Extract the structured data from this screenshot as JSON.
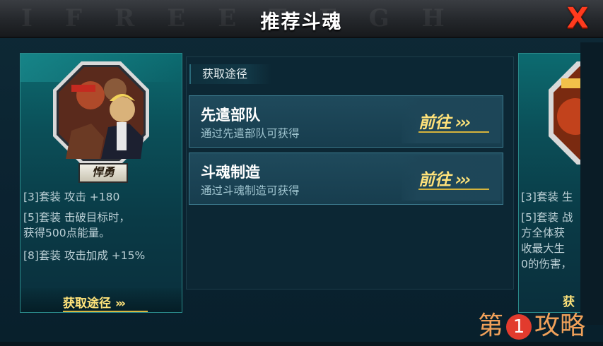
{
  "title": "推荐斗魂",
  "close_label": "X",
  "left_card": {
    "name": "悍勇",
    "set_bonuses": [
      "[3]套装 攻击 +180",
      "[5]套装 击破目标时，",
      "获得500点能量。",
      "[8]套装 攻击加成 +15%"
    ],
    "footer_label": "获取途径"
  },
  "section_label": "获取途径",
  "routes": [
    {
      "name": "先遣部队",
      "desc": "通过先遣部队可获得",
      "button": "前往"
    },
    {
      "name": "斗魂制造",
      "desc": "通过斗魂制造可获得",
      "button": "前往"
    }
  ],
  "right_card": {
    "lines": [
      "[3]套装 生",
      "[5]套装 战",
      "方全体获",
      "收最大生",
      "0的伤害，"
    ],
    "footer_label": "获"
  },
  "watermark": {
    "pre": "第",
    "num": "1",
    "post": "攻略"
  },
  "colors": {
    "accent_gold": "#ffe27a",
    "close_red": "#ff3b1e",
    "teal": "#0c6b70"
  }
}
